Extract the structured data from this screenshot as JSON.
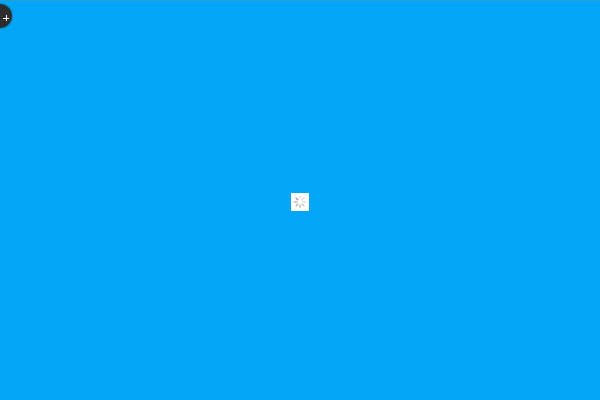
{
  "colors": {
    "background": "#03a6f6",
    "corner_button": "#2d2d2d",
    "loader_box": "#ffffff",
    "spinner": "#9e9e9e"
  },
  "corner_button": {
    "icon": "plus-icon"
  },
  "loader": {
    "icon": "spinner-icon",
    "state": "loading"
  }
}
